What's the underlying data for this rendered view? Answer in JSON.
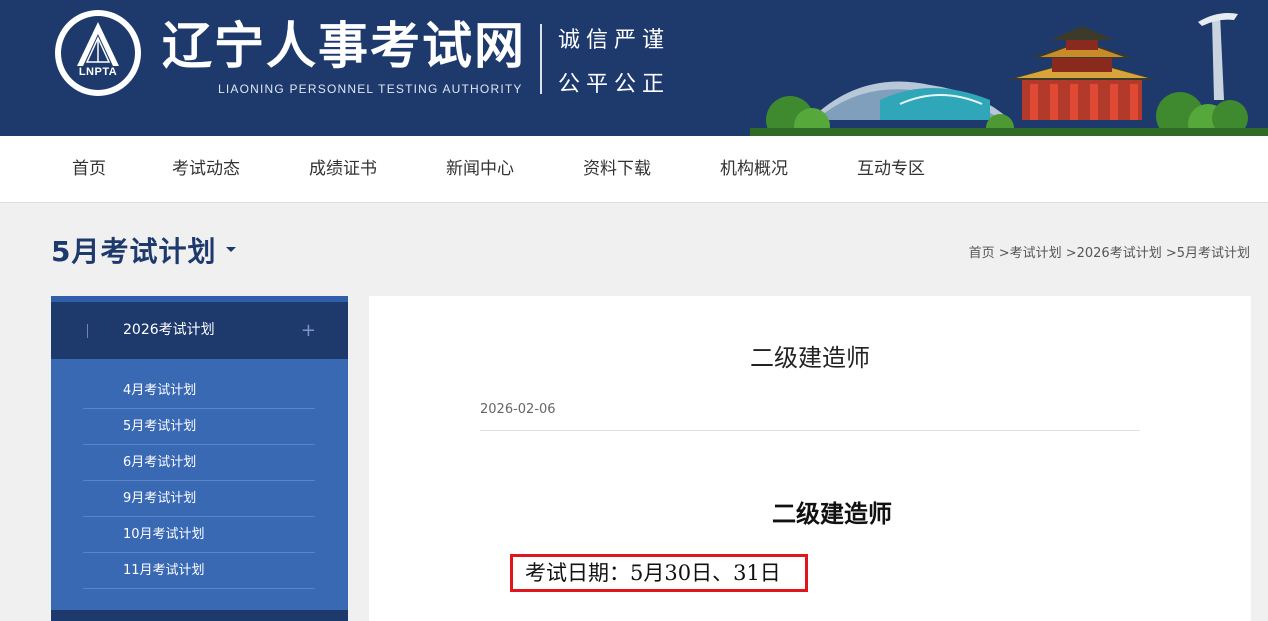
{
  "header": {
    "logo_abbr": "LNPTA",
    "title": "辽宁人事考试网",
    "subtitle": "LIAONING PERSONNEL TESTING AUTHORITY",
    "motto_line1": "诚信严谨",
    "motto_line2": "公平公正"
  },
  "nav": {
    "items": [
      {
        "label": "首页"
      },
      {
        "label": "考试动态"
      },
      {
        "label": "成绩证书"
      },
      {
        "label": "新闻中心"
      },
      {
        "label": "资料下载"
      },
      {
        "label": "机构概况"
      },
      {
        "label": "互动专区"
      }
    ]
  },
  "page": {
    "section_title": "5月考试计划",
    "breadcrumb": "首页 >考试计划 >2026考试计划 >5月考试计划"
  },
  "sidebar": {
    "group_label": "2026考试计划",
    "group_toggle": "+",
    "items": [
      {
        "label": "4月考试计划"
      },
      {
        "label": "5月考试计划"
      },
      {
        "label": "6月考试计划"
      },
      {
        "label": "9月考试计划"
      },
      {
        "label": "10月考试计划"
      },
      {
        "label": "11月考试计划"
      }
    ]
  },
  "article": {
    "title": "二级建造师",
    "date": "2026-02-06",
    "body_heading": "二级建造师",
    "exam_date": "考试日期：5月30日、31日"
  },
  "colors": {
    "brand_navy": "#1e3a6d",
    "sidebar_blue": "#3a69b4",
    "highlight_red": "#e0161c"
  }
}
